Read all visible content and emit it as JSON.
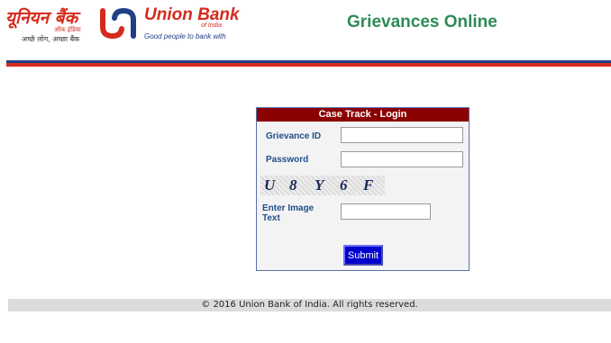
{
  "header": {
    "logo_hindi": {
      "main": "यूनियन बैंक",
      "sub": "ऑफ इंडिया",
      "tagline": "अच्छे लोग, अच्छा बैंक"
    },
    "logo_english": {
      "main": "Union Bank",
      "sub": "of India",
      "tagline": "Good people to bank with"
    },
    "site_title": "Grievances Online",
    "colors": {
      "brand_red": "#d52b1e",
      "brand_blue": "#1f3f86",
      "title_green": "#2e8b57"
    }
  },
  "login": {
    "title": "Case Track - Login",
    "grievance_id_label": "Grievance ID",
    "grievance_id_value": "",
    "password_label": "Password",
    "password_value": "",
    "captcha_chars": [
      "U",
      "8",
      "Y",
      "6",
      "F"
    ],
    "image_text_label": "Enter Image Text",
    "image_text_value": "",
    "submit_label": "Submit"
  },
  "footer": {
    "copyright": "© 2016 Union Bank of India. All rights reserved."
  }
}
